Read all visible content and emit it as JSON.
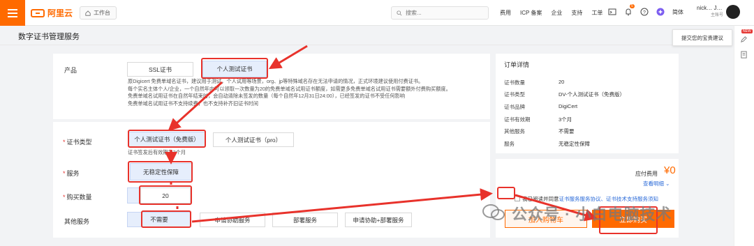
{
  "header": {
    "brand": "阿里云",
    "workbench": "工作台",
    "search_placeholder": "搜索...",
    "nav": [
      "费用",
      "ICP 备案",
      "企业",
      "支持",
      "工单"
    ],
    "notification_count": "5",
    "lang": "简体",
    "user_name": "nick…  J…",
    "user_role": "主账号"
  },
  "page": {
    "title": "数字证书管理服务"
  },
  "product": {
    "label": "产品",
    "options": [
      "SSL证书",
      "个人测试证书"
    ],
    "selected": "个人测试证书",
    "description": [
      "原Digicert 免费单域名证书，建议用于测试，个人试用等场景，org、jp等特殊域名存在无法申请的情况，正式环境建议使用付费证书。",
      "每个实名主体个人/企业，一个自然年内可以领取一次数量为20的免费单域名试用证书额度，如需更多免费单域名试用证书需要额外付费购买额度。",
      "免费单域名试用证书在自然年结束时，会自动清除未签发的数量（每个自然年12月31日24:00），已经签发的证书不受任何影响",
      "免费单域名试用证书不支持续费，也不支持补齐旧证书时间"
    ]
  },
  "cert_type": {
    "label": "证书类型",
    "options": [
      "个人测试证书（免费版）",
      "个人测试证书（pro）"
    ],
    "selected": "个人测试证书（免费版）",
    "hint": "证书签发后有效期为3个月"
  },
  "service": {
    "label": "服务",
    "options": [
      "无稳定性保障"
    ]
  },
  "quantity": {
    "label": "购买数量",
    "value": "20"
  },
  "other_service": {
    "label": "其他服务",
    "options": [
      "不需要",
      "申请协助服务",
      "部署服务",
      "申请协助+部署服务"
    ],
    "selected": "不需要"
  },
  "order": {
    "title": "订单详情",
    "rows": [
      {
        "k": "证书数量",
        "v": "20"
      },
      {
        "k": "证书类型",
        "v": "DV-个人测试证书（免费版）"
      },
      {
        "k": "证书品牌",
        "v": "DigiCert"
      },
      {
        "k": "证书有效期",
        "v": "3个月"
      },
      {
        "k": "其他服务",
        "v": "不需要"
      },
      {
        "k": "服务",
        "v": "无稳定性保障"
      }
    ],
    "fee_label": "应付费用",
    "fee_value": "¥0",
    "detail_link": "查看明细",
    "agree_prefix": "我已阅读并同意",
    "agree_link": "证书服务服务协议、证书技术支持服务须知",
    "cart_button": "加入购物车",
    "buy_button": "立即购买"
  },
  "feedback": "提交您的宝贵建议",
  "new_tag": "NEW",
  "watermark": "公众号 · 小白电脑技术",
  "colors": {
    "accent": "#ff6a00",
    "annotation": "#e8322b",
    "selected_bg": "#e6eefc",
    "link": "#2a6ad8"
  }
}
